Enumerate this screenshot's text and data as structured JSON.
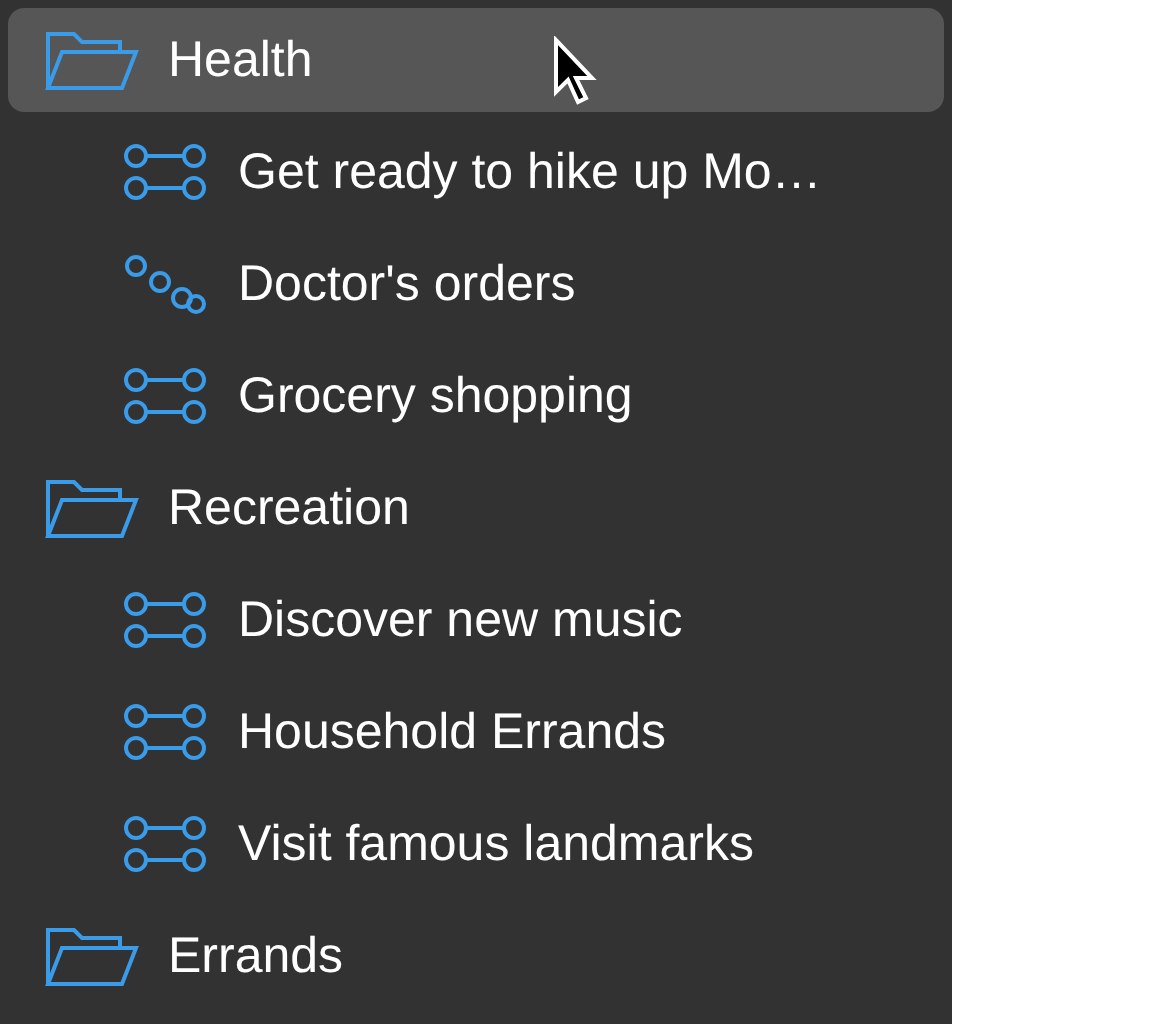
{
  "sidebar": {
    "items": [
      {
        "kind": "folder",
        "label": "Health",
        "selected": true,
        "children": [
          {
            "kind": "project",
            "label": "Get ready to hike up Mo…",
            "selected": false
          },
          {
            "kind": "single-actions",
            "label": "Doctor's orders",
            "selected": false
          },
          {
            "kind": "project",
            "label": "Grocery shopping",
            "selected": false
          }
        ]
      },
      {
        "kind": "folder",
        "label": "Recreation",
        "selected": false,
        "children": [
          {
            "kind": "project",
            "label": "Discover new music",
            "selected": false
          },
          {
            "kind": "project",
            "label": "Household Errands",
            "selected": false
          },
          {
            "kind": "project",
            "label": "Visit famous landmarks",
            "selected": false
          }
        ]
      },
      {
        "kind": "folder",
        "label": "Errands",
        "selected": false
      }
    ]
  }
}
